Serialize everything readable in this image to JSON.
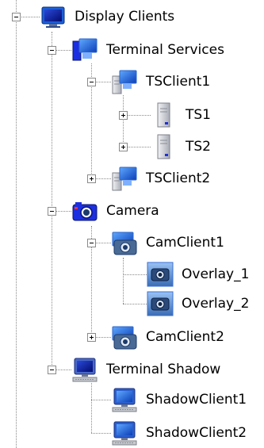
{
  "tree": {
    "root": {
      "label": "Display Clients",
      "icon": "monitor-icon"
    },
    "terminal_services": {
      "label": "Terminal Services",
      "icon": "terminal-services-icon",
      "children": {
        "tsclient1": {
          "label": "TSClient1",
          "icon": "ts-client-icon",
          "children": {
            "ts1": {
              "label": "TS1",
              "icon": "server-tower-icon"
            },
            "ts2": {
              "label": "TS2",
              "icon": "server-tower-icon"
            }
          }
        },
        "tsclient2": {
          "label": "TSClient2",
          "icon": "ts-client-icon"
        }
      }
    },
    "camera": {
      "label": "Camera",
      "icon": "camera-icon",
      "children": {
        "camclient1": {
          "label": "CamClient1",
          "icon": "camera-client-icon",
          "children": {
            "overlay1": {
              "label": "Overlay_1",
              "icon": "overlay-camera-icon"
            },
            "overlay2": {
              "label": "Overlay_2",
              "icon": "overlay-camera-icon"
            }
          }
        },
        "camclient2": {
          "label": "CamClient2",
          "icon": "camera-client-icon"
        }
      }
    },
    "terminal_shadow": {
      "label": "Terminal Shadow",
      "icon": "terminal-shadow-icon",
      "children": {
        "shadowclient1": {
          "label": "ShadowClient1",
          "icon": "shadow-client-icon"
        },
        "shadowclient2": {
          "label": "ShadowClient2",
          "icon": "shadow-client-icon"
        }
      }
    }
  },
  "colors": {
    "connector": "#8a8a8a",
    "monitor_blue": "#1c5fd8",
    "screen_dark": "#0a1f8f",
    "server_gray": "#c7c9cf",
    "camera_dark": "#1b3a6b",
    "selection_frame": "#3b6fd6"
  }
}
